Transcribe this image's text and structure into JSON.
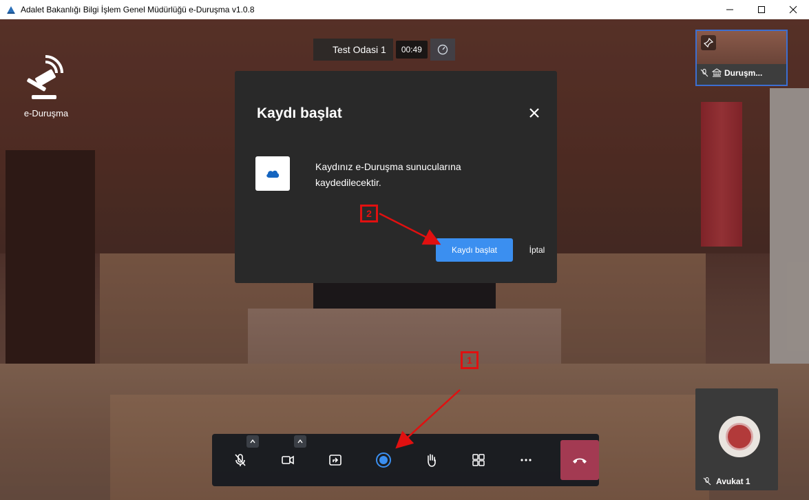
{
  "window": {
    "title": "Adalet Bakanlığı Bilgi İşlem Genel Müdürlüğü e-Duruşma v1.0.8",
    "minimize": "minimize-icon",
    "maximize": "maximize-icon",
    "close": "close-icon"
  },
  "logo": {
    "text": "e-Duruşma"
  },
  "meeting": {
    "room": "Test Odasi 1",
    "timer": "00:49"
  },
  "thumbnails": {
    "top_label": "Duruşm...",
    "bottom_label": "Avukat 1"
  },
  "modal": {
    "title": "Kaydı başlat",
    "message": "Kaydınız e-Duruşma sunucularına kaydedilecektir.",
    "confirm_label": "Kaydı başlat",
    "cancel_label": "İptal"
  },
  "annotations": {
    "step1": "1",
    "step2": "2",
    "color": "#e01010"
  },
  "colors": {
    "primary": "#3b8ff0",
    "hangup": "#a33a52",
    "thumb_border": "#3c6fd1",
    "record": "#3b8ff0"
  }
}
